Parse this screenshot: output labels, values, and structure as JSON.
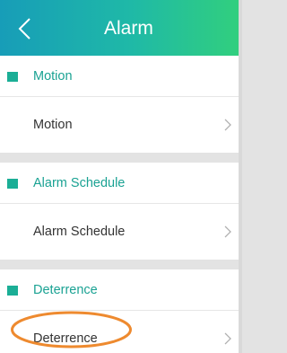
{
  "header": {
    "title": "Alarm",
    "back_icon": "chevron-left-icon",
    "gradient_colors": [
      "#179db8",
      "#1fb9a7",
      "#31cf7e"
    ]
  },
  "sections": [
    {
      "title": "Motion",
      "marker_color": "#1bae96",
      "row_label": "Motion",
      "row_icon": "chevron-right-icon"
    },
    {
      "title": "Alarm Schedule",
      "marker_color": "#1bae96",
      "row_label": "Alarm Schedule",
      "row_icon": "chevron-right-icon"
    },
    {
      "title": "Deterrence",
      "marker_color": "#1bae96",
      "row_label": "Deterrence",
      "row_icon": "chevron-right-icon"
    }
  ],
  "annotation": {
    "highlight_color": "#ee8a2f",
    "highlighted_item": "Deterrence"
  }
}
